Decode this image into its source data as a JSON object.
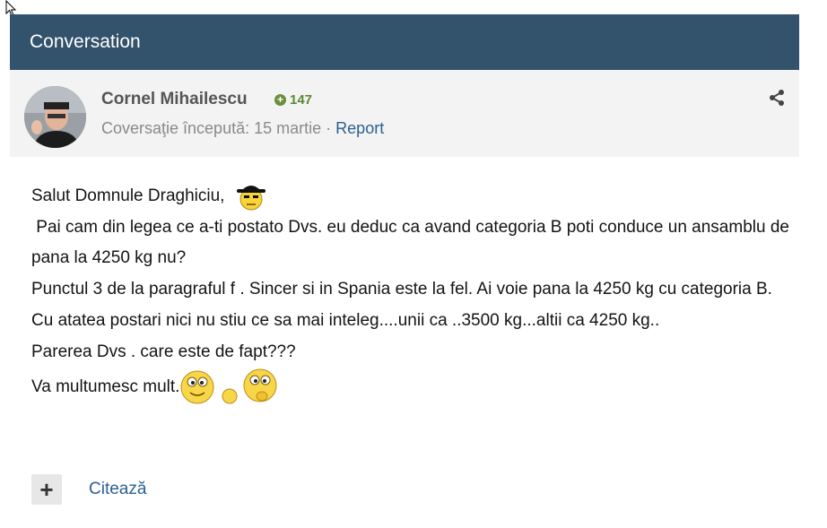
{
  "header": {
    "title": "Conversation"
  },
  "author": {
    "name": "Cornel Mihailescu",
    "reputation": "147",
    "started_label": "Coversaţie începută: 15 martie",
    "separator": "·",
    "report_label": "Report"
  },
  "post": {
    "greeting": "Salut Domnule Draghiciu,  ",
    "lines": [
      " Pai cam din legea ce a-ti postato Dvs. eu deduc ca avand categoria B poti conduce un ansamblu de pana la 4250 kg nu?",
      "Punctul 3 de la paragraful f . Sincer si in Spania este la fel. Ai voie pana la 4250 kg cu categoria B.",
      "Cu atatea postari nici nu stiu ce sa mai inteleg....unii ca ..3500 kg...altii ca 4250 kg..",
      "Parerea Dvs . care este de fapt???"
    ],
    "closing": "Va multumesc mult."
  },
  "footer": {
    "plus_label": "+",
    "quote_label": "Citează"
  },
  "icons": {
    "share": "share-icon",
    "reputation": "plus-circle-icon",
    "cursor": "mouse-pointer-icon"
  },
  "colors": {
    "header_bg": "#33526b",
    "link": "#2d5f8e",
    "reputation": "#5a8a2f",
    "author_bar_bg": "#f3f3f3"
  }
}
